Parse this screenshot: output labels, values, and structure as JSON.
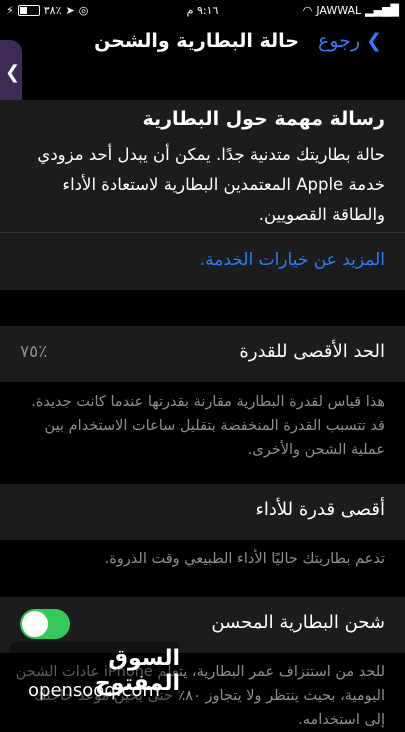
{
  "status_bar": {
    "battery_percent": "٣٨٪",
    "time": "٩:١٦ م",
    "carrier": "JAWWAL"
  },
  "nav": {
    "back_label": "رجوع",
    "title": "حالة البطارية والشحن"
  },
  "alert": {
    "title": "رسالة مهمة حول البطارية",
    "body": "حالة بطاريتك متدنية جدًا. يمكن أن يبدل أحد مزودي خدمة Apple المعتمدين البطارية لاستعادة الأداء والطاقة القصويين.",
    "link": "المزيد عن خيارات الخدمة."
  },
  "max_capacity": {
    "label": "الحد الأقصى للقدرة",
    "value": "٧٥٪",
    "footnote": "هذا قياس لقدرة البطارية مقارنة بقدرتها عندما كانت جديدة. قد تتسبب القدرة المنخفضة بتقليل ساعات الاستخدام بين عملية الشحن والأخرى."
  },
  "peak_performance": {
    "label": "أقصى قدرة للأداء",
    "footnote": "تدعم بطاريتك حاليًا الأداء الطبيعي وقت الذروة."
  },
  "optimized_charging": {
    "label": "شحن البطارية المحسن",
    "enabled": true,
    "footnote": "للحد من استنزاف عمر البطارية، يتعلم iPhone عادات الشحن اليومية، بحيث ينتظر ولا يتجاوز ٨٠٪ حتى يحين موعد حاجتك إلى استخدامه."
  },
  "watermark": {
    "arabic": "السوق المفتوح",
    "latin": "opensooq.com"
  },
  "colors": {
    "accent": "#2d7df6",
    "toggle_on": "#34c759",
    "card_bg": "#1c1c1e"
  }
}
